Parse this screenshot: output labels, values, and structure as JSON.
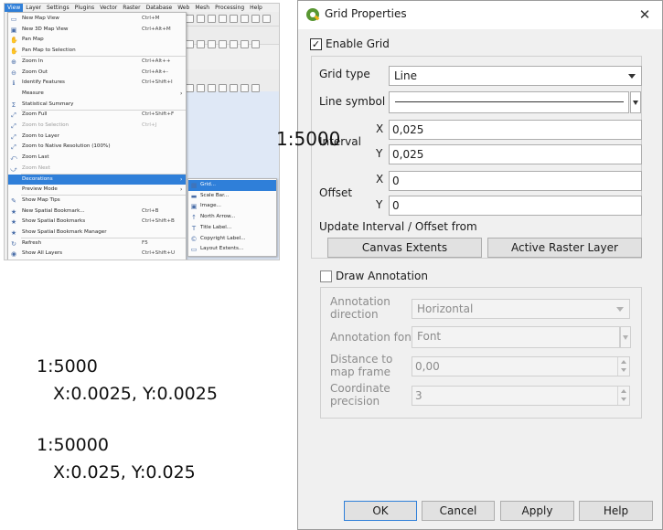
{
  "menubar": [
    "View",
    "Layer",
    "Settings",
    "Plugins",
    "Vector",
    "Raster",
    "Database",
    "Web",
    "Mesh",
    "Processing",
    "Help"
  ],
  "view_menu": [
    {
      "label": "New Map View",
      "shortcut": "Ctrl+M",
      "icon": "new-map-view-icon",
      "glyph": "▭",
      "state": "normal"
    },
    {
      "label": "New 3D Map View",
      "shortcut": "Ctrl+Alt+M",
      "icon": "new-3d-map-view-icon",
      "glyph": "▣",
      "state": "normal"
    },
    {
      "label": "Pan Map",
      "shortcut": "",
      "icon": "pan-icon",
      "glyph": "✋",
      "state": "normal"
    },
    {
      "label": "Pan Map to Selection",
      "shortcut": "",
      "icon": "pan-to-selection-icon",
      "glyph": "✋",
      "state": "normal"
    },
    {
      "label": "Zoom In",
      "shortcut": "Ctrl+Alt++",
      "icon": "zoom-in-icon",
      "glyph": "⊕",
      "state": "normal"
    },
    {
      "label": "Zoom Out",
      "shortcut": "Ctrl+Alt+-",
      "icon": "zoom-out-icon",
      "glyph": "⊖",
      "state": "normal"
    },
    {
      "label": "Identify Features",
      "shortcut": "Ctrl+Shift+I",
      "icon": "identify-icon",
      "glyph": "ℹ",
      "state": "normal"
    },
    {
      "label": "Measure",
      "shortcut": "",
      "icon": "",
      "glyph": "",
      "state": "submenu"
    },
    {
      "label": "Statistical Summary",
      "shortcut": "",
      "icon": "sum-icon",
      "glyph": "Σ",
      "state": "normal"
    },
    {
      "label": "Zoom Full",
      "shortcut": "Ctrl+Shift+F",
      "icon": "zoom-full-icon",
      "glyph": "⤢",
      "state": "normal"
    },
    {
      "label": "Zoom to Selection",
      "shortcut": "Ctrl+J",
      "icon": "zoom-selection-icon",
      "glyph": "⤢",
      "state": "disabled"
    },
    {
      "label": "Zoom to Layer",
      "shortcut": "",
      "icon": "zoom-layer-icon",
      "glyph": "⤢",
      "state": "normal"
    },
    {
      "label": "Zoom to Native Resolution (100%)",
      "shortcut": "",
      "icon": "zoom-native-icon",
      "glyph": "⤢",
      "state": "normal"
    },
    {
      "label": "Zoom Last",
      "shortcut": "",
      "icon": "zoom-last-icon",
      "glyph": "⤺",
      "state": "normal"
    },
    {
      "label": "Zoom Next",
      "shortcut": "",
      "icon": "zoom-next-icon",
      "glyph": "⤻",
      "state": "disabled"
    },
    {
      "label": "Decorations",
      "shortcut": "",
      "icon": "",
      "glyph": "",
      "state": "highlighted"
    },
    {
      "label": "Preview Mode",
      "shortcut": "",
      "icon": "",
      "glyph": "",
      "state": "submenu"
    },
    {
      "label": "Show Map Tips",
      "shortcut": "",
      "icon": "map-tips-icon",
      "glyph": "✎",
      "state": "normal"
    },
    {
      "label": "New Spatial Bookmark...",
      "shortcut": "Ctrl+B",
      "icon": "bookmark-icon",
      "glyph": "★",
      "state": "normal"
    },
    {
      "label": "Show Spatial Bookmarks",
      "shortcut": "Ctrl+Shift+B",
      "icon": "bookmarks-icon",
      "glyph": "★",
      "state": "normal"
    },
    {
      "label": "Show Spatial Bookmark Manager",
      "shortcut": "",
      "icon": "bookmark-manager-icon",
      "glyph": "★",
      "state": "normal"
    },
    {
      "label": "Refresh",
      "shortcut": "F5",
      "icon": "refresh-icon",
      "glyph": "↻",
      "state": "normal"
    },
    {
      "label": "Show All Layers",
      "shortcut": "Ctrl+Shift+U",
      "icon": "show-layers-icon",
      "glyph": "◉",
      "state": "normal"
    }
  ],
  "decorations_submenu": [
    {
      "label": "Grid...",
      "icon": "grid-icon",
      "glyph": "▦",
      "state": "highlighted"
    },
    {
      "label": "Scale Bar...",
      "icon": "scale-bar-icon",
      "glyph": "▬",
      "state": "normal"
    },
    {
      "label": "Image...",
      "icon": "image-icon",
      "glyph": "▣",
      "state": "normal"
    },
    {
      "label": "North Arrow...",
      "icon": "north-arrow-icon",
      "glyph": "↑",
      "state": "normal"
    },
    {
      "label": "Title Label...",
      "icon": "title-label-icon",
      "glyph": "T",
      "state": "normal"
    },
    {
      "label": "Copyright Label...",
      "icon": "copyright-icon",
      "glyph": "©",
      "state": "normal"
    },
    {
      "label": "Layout Extents...",
      "icon": "layout-extents-icon",
      "glyph": "▭",
      "state": "normal"
    }
  ],
  "notes": [
    {
      "scale": "1:5000",
      "xy": "X:0.0025,  Y:0.0025"
    },
    {
      "scale": "1:50000",
      "xy": "X:0.025,  Y:0.025"
    }
  ],
  "dialog": {
    "title": "Grid Properties",
    "close_glyph": "✕",
    "enable_grid_label": "Enable Grid",
    "enable_grid_checked": "✓",
    "grid_type_label": "Grid type",
    "grid_type_value": "Line",
    "line_symbol_label": "Line symbol",
    "interval_label": "Interval",
    "offset_label": "Offset",
    "x_label": "X",
    "y_label": "Y",
    "interval_x": "0,025",
    "interval_y": "0,025",
    "offset_x": "0",
    "offset_y": "0",
    "scale_overlay": "1:5000",
    "update_from_label": "Update Interval / Offset from",
    "canvas_extents_button": "Canvas Extents",
    "active_raster_button": "Active Raster Layer",
    "draw_annotation_label": "Draw Annotation",
    "annotation_direction_label_1": "Annotation",
    "annotation_direction_label_2": "direction",
    "annotation_direction_value": "Horizontal",
    "annotation_font_label": "Annotation font",
    "annotation_font_value": "Font",
    "distance_label_1": "Distance to",
    "distance_label_2": "map frame",
    "distance_value": "0,00",
    "precision_label_1": "Coordinate",
    "precision_label_2": "precision",
    "precision_value": "3",
    "ok_button": "OK",
    "cancel_button": "Cancel",
    "apply_button": "Apply",
    "help_button": "Help"
  }
}
